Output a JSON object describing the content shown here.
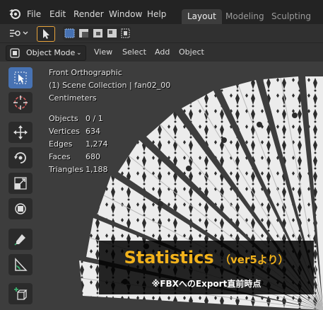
{
  "menus": [
    "File",
    "Edit",
    "Render",
    "Window",
    "Help"
  ],
  "workspaces": [
    "Layout",
    "Modeling",
    "Sculpting"
  ],
  "header": {
    "mode": "Object Mode",
    "items": [
      "View",
      "Select",
      "Add",
      "Object"
    ]
  },
  "overlay": {
    "view_name": "Front Orthographic",
    "collection": "(1) Scene Collection | fan02_00",
    "units": "Centimeters"
  },
  "statistics": [
    {
      "label": "Objects",
      "value": "0 / 1"
    },
    {
      "label": "Vertices",
      "value": "634"
    },
    {
      "label": "Edges",
      "value": "1,274"
    },
    {
      "label": "Faces",
      "value": "680"
    },
    {
      "label": "Triangles",
      "value": "1,188"
    }
  ],
  "caption": {
    "title": "Statistics",
    "subtitle": "（ver5より）",
    "note": "※FBXへのExport直前時点"
  },
  "colors": {
    "accent": "#4772b3",
    "caption_title": "#f2b21b",
    "active_orange": "#e8a33a"
  },
  "tools": [
    "select-box-icon",
    "cursor-icon",
    "move-icon",
    "rotate-icon",
    "scale-icon",
    "transform-icon",
    "annotate-icon",
    "measure-icon",
    "add-cube-icon"
  ]
}
